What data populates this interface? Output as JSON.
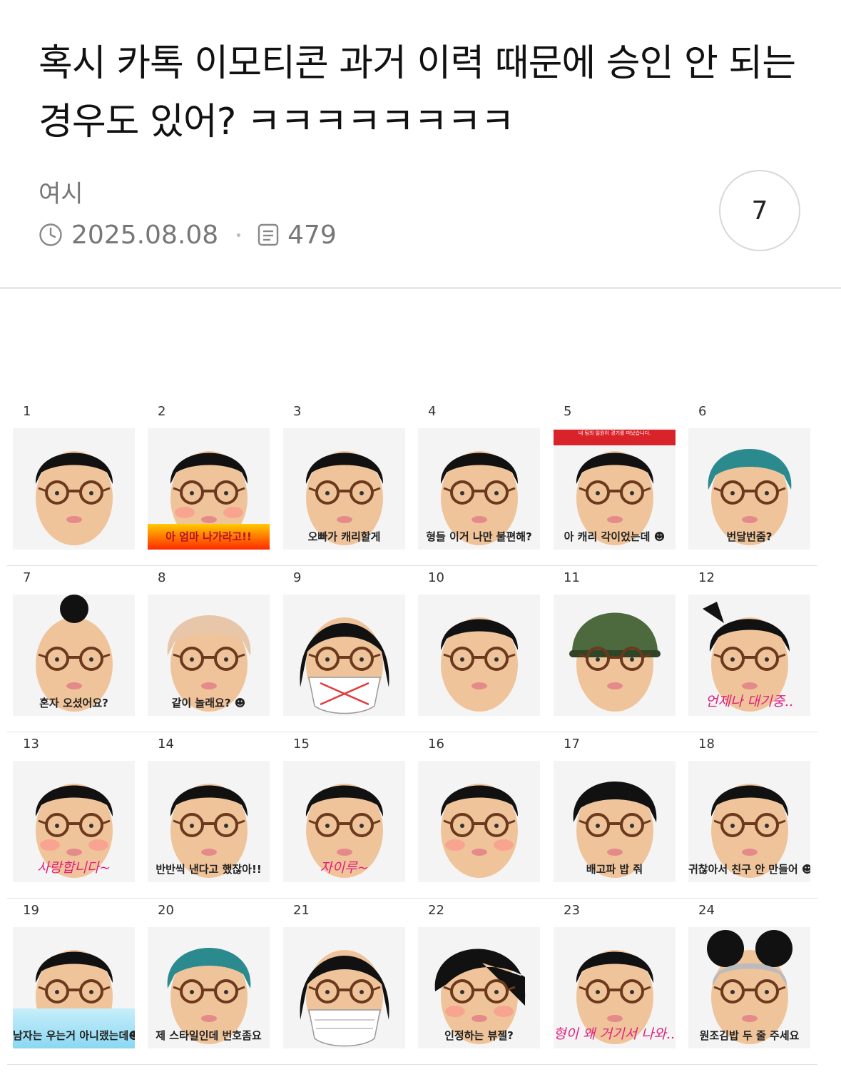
{
  "post": {
    "title": "혹시 카톡 이모티콘 과거 이력 때문에 승인 안 되는 경우도 있어? ㅋㅋㅋㅋㅋㅋㅋㅋ",
    "author": "여시",
    "date": "2025.08.08",
    "views": "479",
    "comment_count": "7"
  },
  "emoticons": [
    {
      "num": "1",
      "caption": ""
    },
    {
      "num": "2",
      "caption": "아 엄마 나가라고!!"
    },
    {
      "num": "3",
      "caption": "오빠가 캐리할게"
    },
    {
      "num": "4",
      "caption": "형들 이거 나만 불편해?"
    },
    {
      "num": "5",
      "caption": "아 캐리 각이었는데 ☻",
      "banner": "내 팀의 일원이 경기를 떠났습니다."
    },
    {
      "num": "6",
      "caption": "번달번줌?"
    },
    {
      "num": "7",
      "caption": "혼자 오셨어요?"
    },
    {
      "num": "8",
      "caption": "같이 놀래요? ☻"
    },
    {
      "num": "9",
      "caption": ""
    },
    {
      "num": "10",
      "caption": ""
    },
    {
      "num": "11",
      "caption": ""
    },
    {
      "num": "12",
      "caption": "언제나 대기중.."
    },
    {
      "num": "13",
      "caption": "사랑합니다~"
    },
    {
      "num": "14",
      "caption": "반반씩 낸다고 했잖아!!"
    },
    {
      "num": "15",
      "caption": "자이루~"
    },
    {
      "num": "16",
      "caption": ""
    },
    {
      "num": "17",
      "caption": "배고파 밥 줘"
    },
    {
      "num": "18",
      "caption": "귀찮아서 친구 안 만들어 ☻"
    },
    {
      "num": "19",
      "caption": "남자는 우는거 아니랬는데☻"
    },
    {
      "num": "20",
      "caption": "제 스타일인데 번호좀요"
    },
    {
      "num": "21",
      "caption": ""
    },
    {
      "num": "22",
      "caption": "인정하는 뷰젤?"
    },
    {
      "num": "23",
      "caption": "형이 왜 거기서 나와..?"
    },
    {
      "num": "24",
      "caption": "원조김밥 두 줄 주세요"
    }
  ],
  "colors": {
    "skin": "#f0c49a",
    "hair": "#111111",
    "glasses": "#6b3a1e",
    "teal_hair": "#2a8a8e",
    "blonde_hair": "#e8c6aa",
    "camo": "#4d6a3e",
    "gray_hair": "#bbbbbb"
  },
  "icons": {
    "clock": "clock-icon",
    "views": "document-icon"
  }
}
